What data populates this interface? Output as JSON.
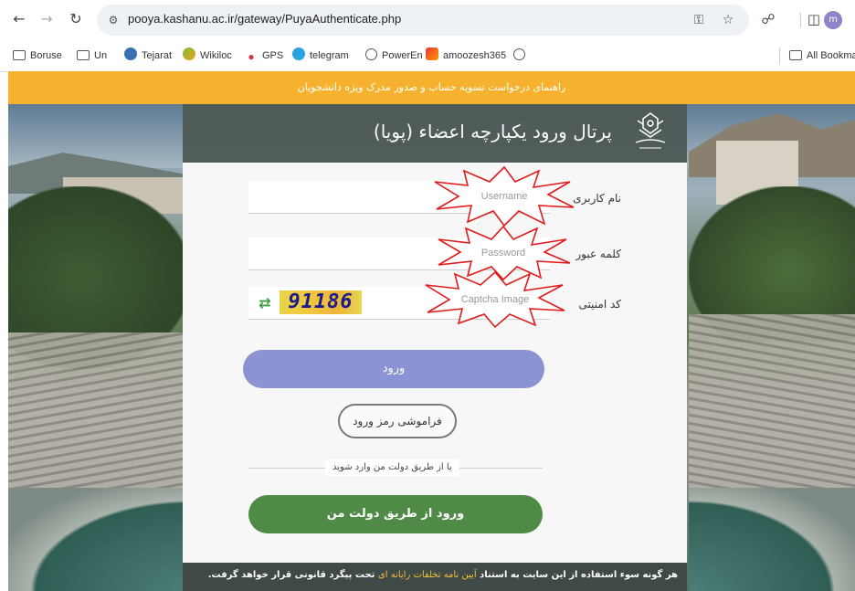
{
  "browser": {
    "url": "pooya.kashanu.ac.ir/gateway/PuyaAuthenticate.php",
    "avatar_letter": "m",
    "bookmarks": [
      {
        "label": "Boruse",
        "icon": "folder-icon"
      },
      {
        "label": "Un",
        "icon": "folder-icon"
      },
      {
        "label": "Tejarat",
        "icon": "tejarat-icon"
      },
      {
        "label": "Wikiloc",
        "icon": "wikiloc-icon"
      },
      {
        "label": "GPS",
        "icon": "map-pin-icon"
      },
      {
        "label": "telegram",
        "icon": "telegram-icon"
      },
      {
        "label": "PowerEn",
        "icon": "poweren-icon"
      },
      {
        "label": "amoozesh365",
        "icon": "amoozesh-icon"
      }
    ],
    "all_bookmarks_label": "All Bookmar"
  },
  "banner": {
    "text": "راهنمای درخواست تسویه حساب و صدور مدرک ویژه دانشجویان",
    "color": "#f6b22f"
  },
  "portal": {
    "title": "پرتال ورود یکپارچه اعضاء (پویا)",
    "username_label": "نام کاربری",
    "username_annotation": "Username",
    "password_label": "کلمه عبور",
    "password_annotation": "Password",
    "captcha_label": "کد امنیتی",
    "captcha_annotation": "Captcha Image",
    "captcha_text": "91186",
    "login_label": "ورود",
    "forgot_label": "فراموشی رمز ورود",
    "or_text": "یا از طریق دولت من وارد شوید",
    "gov_login_label": "ورود از طریق دولت من",
    "colors": {
      "login_button": "#8c93d3",
      "gov_button": "#4f8a46",
      "header": "#4e5a56"
    }
  },
  "footer": {
    "text_before": "هر گونه سوء استفاده از این سایت به استناد ",
    "text_highlight": "آیین نامه تخلفات رایانه ای",
    "text_after": " تحت پیگرد قانونی قرار خواهد گرفت."
  }
}
